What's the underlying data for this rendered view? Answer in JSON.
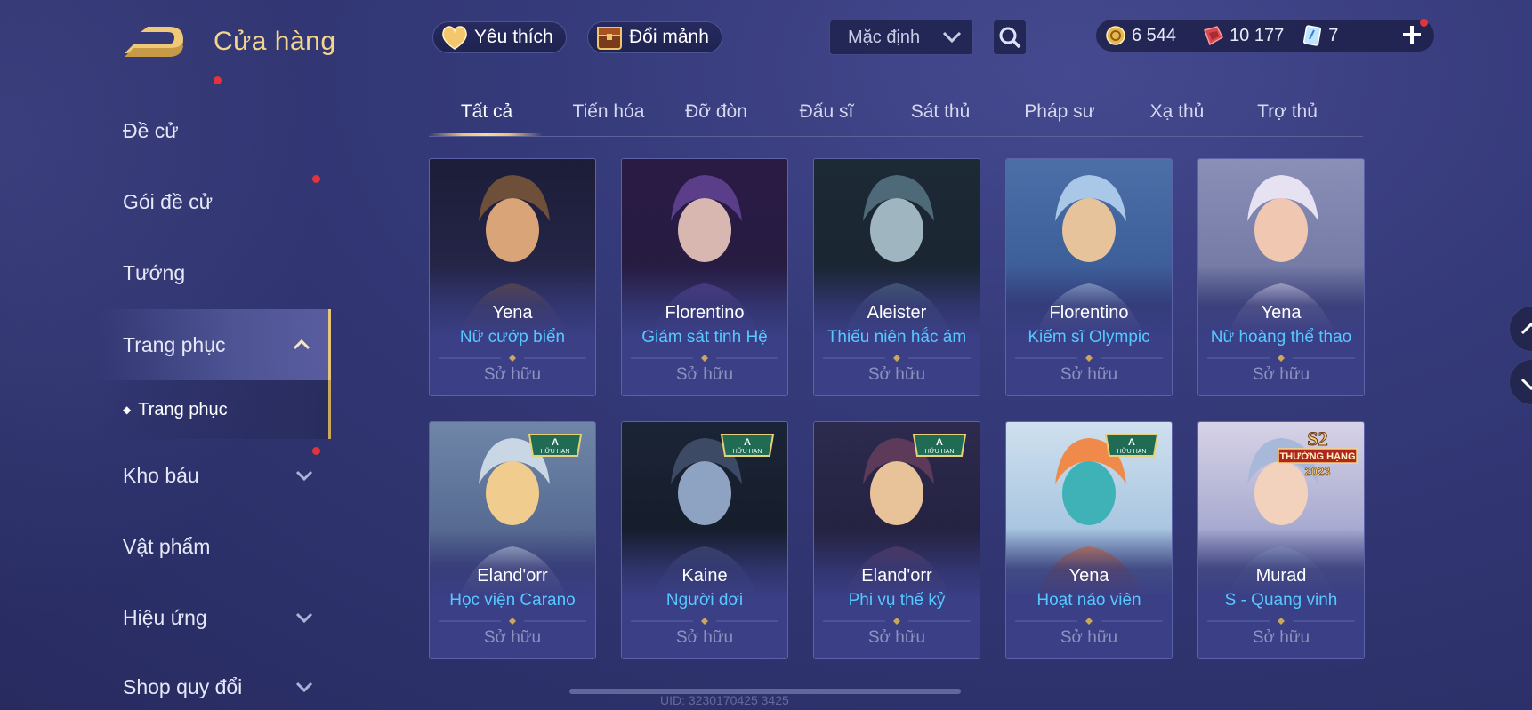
{
  "header": {
    "title": "Cửa hàng",
    "favorites_label": "Yêu thích",
    "exchange_label": "Đổi mảnh",
    "sort": {
      "selected": "Mặc định"
    }
  },
  "currencies": [
    {
      "icon": "gold-coin-icon",
      "value": "6 544"
    },
    {
      "icon": "red-voucher-icon",
      "value": "10 177"
    },
    {
      "icon": "card-ticket-icon",
      "value": "7"
    }
  ],
  "sidebar": {
    "items": [
      {
        "label": "Đề cử"
      },
      {
        "label": "Gói đề cử"
      },
      {
        "label": "Tướng"
      },
      {
        "label": "Trang phục"
      },
      {
        "label": "Kho báu"
      },
      {
        "label": "Vật phẩm"
      },
      {
        "label": "Hiệu ứng"
      },
      {
        "label": "Shop quy đổi"
      }
    ],
    "sub_item": "Trang phục"
  },
  "tabs": [
    "Tất cả",
    "Tiến hóa",
    "Đỡ đòn",
    "Đấu sĩ",
    "Sát thủ",
    "Pháp sư",
    "Xạ thủ",
    "Trợ thủ"
  ],
  "active_tab": "Tất cả",
  "badges": {
    "limited_letter": "A",
    "limited_text": "HỮU HẠN",
    "season": "S2",
    "season_text": "THƯỞNG HẠNG",
    "season_year": "2023"
  },
  "cards": [
    {
      "hero": "Yena",
      "skin": "Nữ cướp biển",
      "status": "Sở hữu"
    },
    {
      "hero": "Florentino",
      "skin": "Giám sát tinh Hệ",
      "status": "Sở hữu"
    },
    {
      "hero": "Aleister",
      "skin": "Thiếu niên hắc ám",
      "status": "Sở hữu"
    },
    {
      "hero": "Florentino",
      "skin": "Kiếm sĩ Olympic",
      "status": "Sở hữu"
    },
    {
      "hero": "Yena",
      "skin": "Nữ hoàng thể thao",
      "status": "Sở hữu"
    },
    {
      "hero": "Eland'orr",
      "skin": "Học viện Carano",
      "status": "Sở hữu"
    },
    {
      "hero": "Kaine",
      "skin": "Người dơi",
      "status": "Sở hữu"
    },
    {
      "hero": "Eland'orr",
      "skin": "Phi vụ thế kỷ",
      "status": "Sở hữu"
    },
    {
      "hero": "Yena",
      "skin": "Hoạt náo viên",
      "status": "Sở hữu"
    },
    {
      "hero": "Murad",
      "skin": "S - Quang vinh",
      "status": "Sở hữu"
    }
  ],
  "footer": {
    "uid": "UID: 3230170425 3425"
  },
  "colors": {
    "accent": "#e9c57a",
    "skin_name": "#57c8ff",
    "notification": "#e2343a",
    "background": "#353a7a"
  }
}
